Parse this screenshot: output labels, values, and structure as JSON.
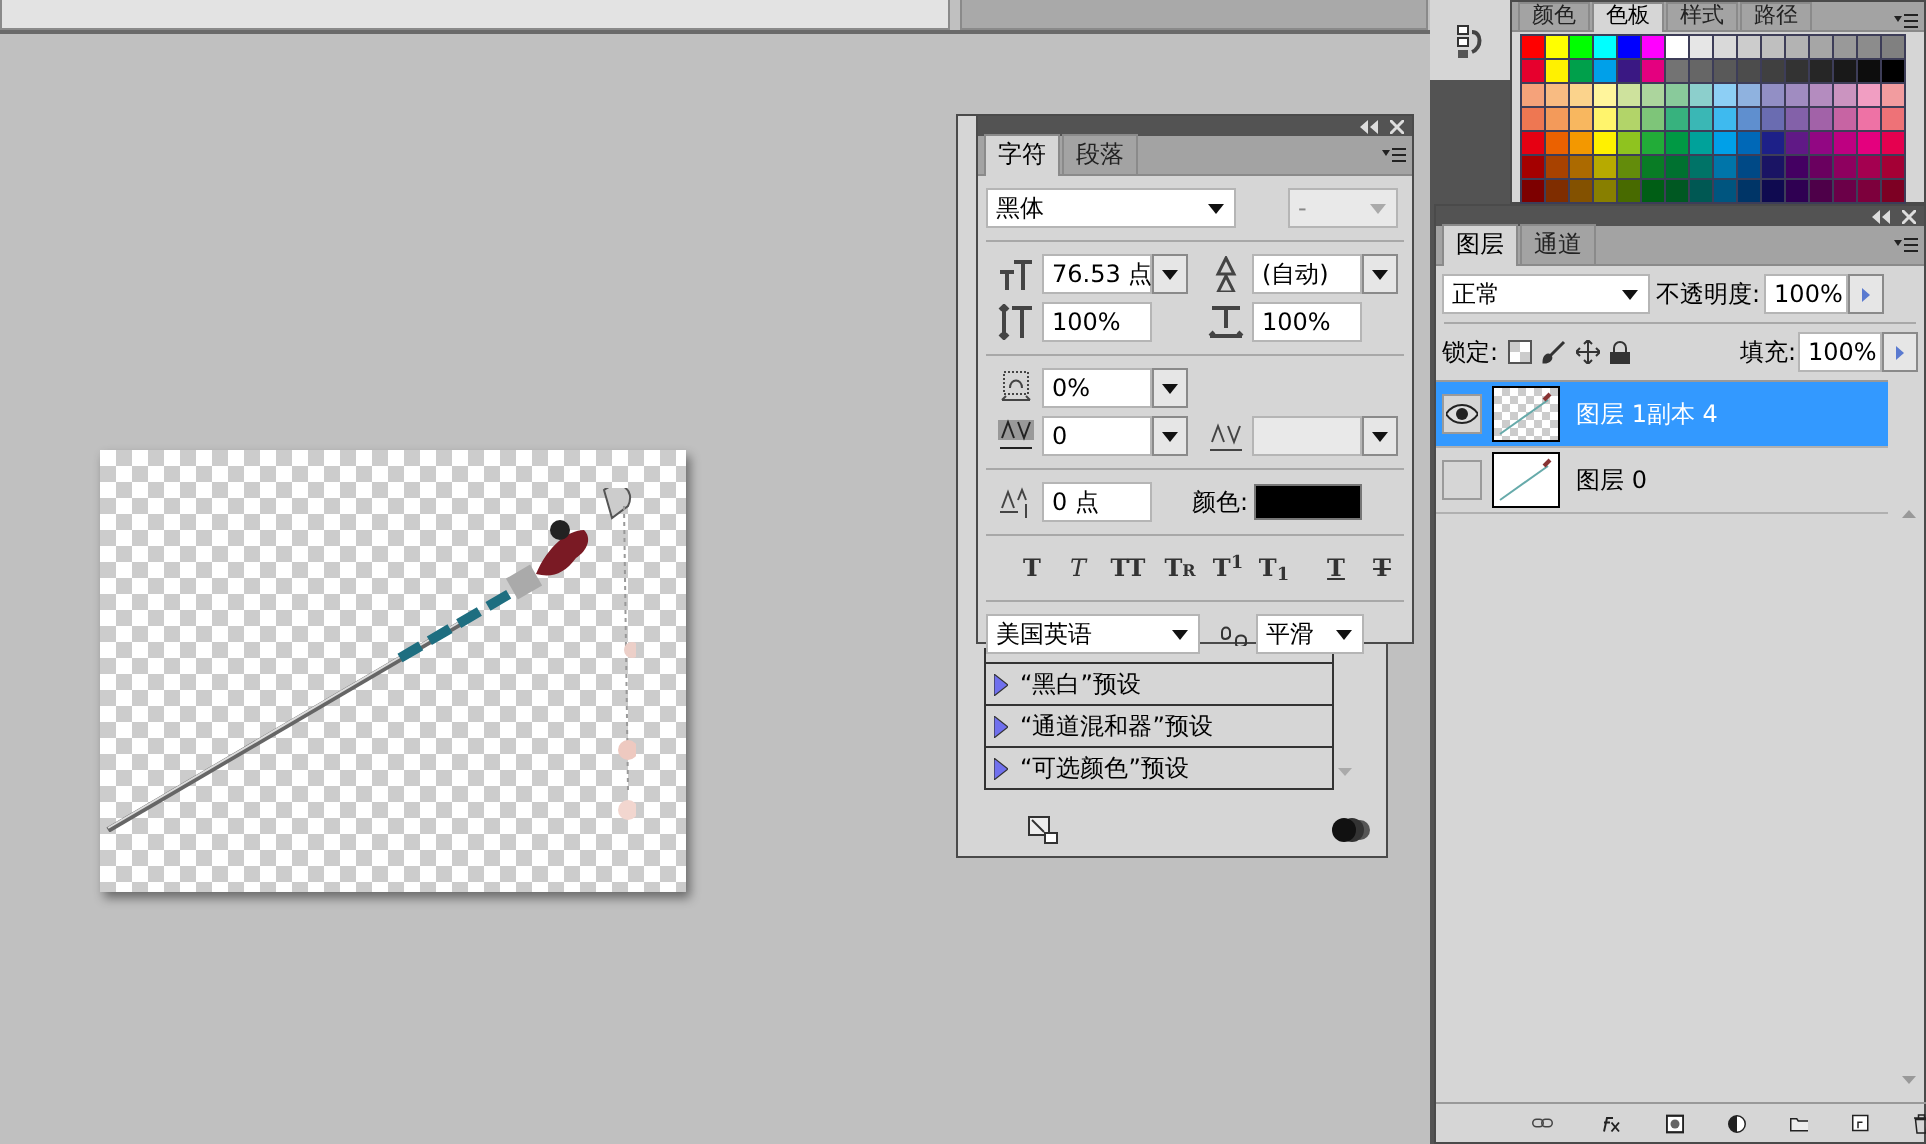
{
  "document_tabs": [
    {
      "selected": true
    },
    {
      "selected": false
    }
  ],
  "adjustments_panel": {
    "presets": [
      {
        "label": "“黑白”预设"
      },
      {
        "label": "“通道混和器”预设"
      },
      {
        "label": "“可选颜色”预设"
      }
    ]
  },
  "character_panel": {
    "tabs": [
      {
        "label": "字符",
        "selected": true
      },
      {
        "label": "段落",
        "selected": false
      }
    ],
    "font_family": "黑体",
    "font_style": "-",
    "font_size": "76.53 点",
    "leading": "(自动)",
    "vertical_scale": "100%",
    "horizontal_scale": "100%",
    "tsume": "0%",
    "kerning": "0",
    "baseline_shift": "0 点",
    "color_label": "颜色:",
    "text_color_swatch": {
      "color": "#000000"
    },
    "style_buttons": [
      {
        "kind": "bold",
        "label": "T"
      },
      {
        "kind": "italic",
        "label": "T"
      },
      {
        "kind": "allcaps",
        "label": "TT"
      },
      {
        "kind": "smallcaps",
        "label": "Tr"
      },
      {
        "kind": "superscript",
        "label": "T$^{1}$"
      },
      {
        "kind": "subscript",
        "label": "T$_{1}$"
      },
      {
        "kind": "underline",
        "label": "T"
      },
      {
        "kind": "strikethrough",
        "label": "T"
      }
    ],
    "language": "美国英语",
    "antialias": "平滑"
  },
  "swatches_panel": {
    "tabs": [
      {
        "label": "颜色",
        "selected": false
      },
      {
        "label": "色板",
        "selected": true
      },
      {
        "label": "样式",
        "selected": false
      },
      {
        "label": "路径",
        "selected": false
      }
    ],
    "swatches": [
      {
        "color": "#ff0000"
      },
      {
        "color": "#ffff00"
      },
      {
        "color": "#00ff00"
      },
      {
        "color": "#00ffff"
      },
      {
        "color": "#0000ff"
      },
      {
        "color": "#ff00ff"
      },
      {
        "color": "#ffffff"
      },
      {
        "color": "#e6e6e6"
      },
      {
        "color": "#d9d9d9"
      },
      {
        "color": "#cccccc"
      },
      {
        "color": "#bfbfbf"
      },
      {
        "color": "#b3b3b3"
      },
      {
        "color": "#a6a6a6"
      },
      {
        "color": "#999999"
      },
      {
        "color": "#8c8c8c"
      },
      {
        "color": "#808080"
      },
      {
        "color": "#e6002d"
      },
      {
        "color": "#fff100"
      },
      {
        "color": "#00a04b"
      },
      {
        "color": "#00a0e9"
      },
      {
        "color": "#3a1883"
      },
      {
        "color": "#e4007f"
      },
      {
        "color": "#737373"
      },
      {
        "color": "#666666"
      },
      {
        "color": "#595959"
      },
      {
        "color": "#4c4c4c"
      },
      {
        "color": "#404040"
      },
      {
        "color": "#333333"
      },
      {
        "color": "#262626"
      },
      {
        "color": "#191919"
      },
      {
        "color": "#0d0d0d"
      },
      {
        "color": "#000000"
      },
      {
        "color": "#f5a27a"
      },
      {
        "color": "#f8bb82"
      },
      {
        "color": "#fbd38c"
      },
      {
        "color": "#fff59c"
      },
      {
        "color": "#cee29d"
      },
      {
        "color": "#acd59d"
      },
      {
        "color": "#89ca9b"
      },
      {
        "color": "#8ccfcc"
      },
      {
        "color": "#8dcff5"
      },
      {
        "color": "#8fb2df"
      },
      {
        "color": "#928fc5"
      },
      {
        "color": "#a08cc1"
      },
      {
        "color": "#b48cbf"
      },
      {
        "color": "#cb94c0"
      },
      {
        "color": "#f19ec2"
      },
      {
        "color": "#f29c9f"
      },
      {
        "color": "#ee7752"
      },
      {
        "color": "#f39a5a"
      },
      {
        "color": "#f8b75f"
      },
      {
        "color": "#fff46c"
      },
      {
        "color": "#b2d469"
      },
      {
        "color": "#7ec579"
      },
      {
        "color": "#37b27e"
      },
      {
        "color": "#3ab7b5"
      },
      {
        "color": "#3ebaef"
      },
      {
        "color": "#5f8fcf"
      },
      {
        "color": "#6a6cb1"
      },
      {
        "color": "#8361a9"
      },
      {
        "color": "#a262a8"
      },
      {
        "color": "#c764a3"
      },
      {
        "color": "#ee72a5"
      },
      {
        "color": "#ee7277"
      },
      {
        "color": "#e60012"
      },
      {
        "color": "#eb6100"
      },
      {
        "color": "#f39800"
      },
      {
        "color": "#fff100"
      },
      {
        "color": "#8fc31f"
      },
      {
        "color": "#22ac38"
      },
      {
        "color": "#009944"
      },
      {
        "color": "#00a29a"
      },
      {
        "color": "#00a0e8"
      },
      {
        "color": "#0068b7"
      },
      {
        "color": "#1d2088"
      },
      {
        "color": "#601986"
      },
      {
        "color": "#920783"
      },
      {
        "color": "#be0081"
      },
      {
        "color": "#e4007e"
      },
      {
        "color": "#e5004f"
      },
      {
        "color": "#a40000"
      },
      {
        "color": "#a84200"
      },
      {
        "color": "#ac6a00"
      },
      {
        "color": "#b7aa00"
      },
      {
        "color": "#638c0b"
      },
      {
        "color": "#097c25"
      },
      {
        "color": "#007130"
      },
      {
        "color": "#007367"
      },
      {
        "color": "#0075a9"
      },
      {
        "color": "#004986"
      },
      {
        "color": "#1a1464"
      },
      {
        "color": "#440062"
      },
      {
        "color": "#6a005f"
      },
      {
        "color": "#8e005f"
      },
      {
        "color": "#a40050"
      },
      {
        "color": "#a40035"
      },
      {
        "color": "#7d0000"
      },
      {
        "color": "#7f2d00"
      },
      {
        "color": "#835100"
      },
      {
        "color": "#887f00"
      },
      {
        "color": "#486a00"
      },
      {
        "color": "#005e15"
      },
      {
        "color": "#005822"
      },
      {
        "color": "#005853"
      },
      {
        "color": "#00557f"
      },
      {
        "color": "#003567"
      },
      {
        "color": "#0f0a50"
      },
      {
        "color": "#2f0052"
      },
      {
        "color": "#4e0049"
      },
      {
        "color": "#6b0048"
      },
      {
        "color": "#7d003c"
      },
      {
        "color": "#7d0023"
      }
    ]
  },
  "layers_panel": {
    "tabs": [
      {
        "label": "图层",
        "selected": true
      },
      {
        "label": "通道",
        "selected": false
      }
    ],
    "blend_mode": "正常",
    "opacity_label": "不透明度:",
    "opacity": "100%",
    "lock_label": "锁定:",
    "fill_label": "填充:",
    "fill": "100%",
    "layers": [
      {
        "name": "图层 1副本 4",
        "selected": true,
        "visible": true
      },
      {
        "name": "图层 0",
        "selected": false,
        "visible": false
      }
    ]
  }
}
